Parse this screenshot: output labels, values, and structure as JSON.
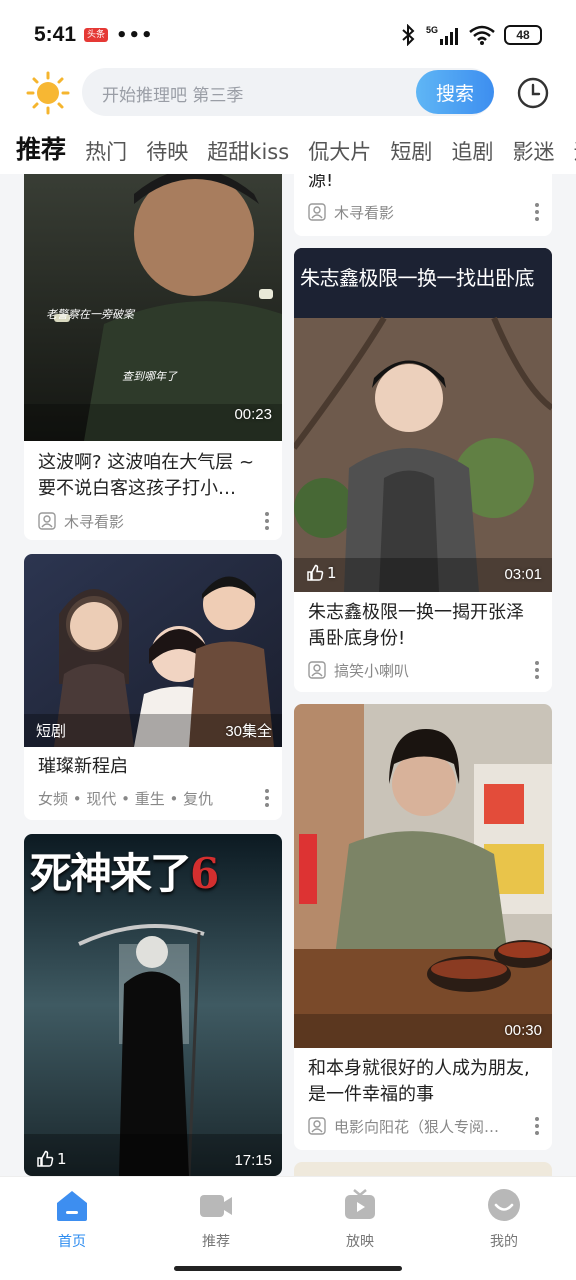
{
  "status_bar": {
    "time": "5:41",
    "badge": "头条",
    "battery": "48",
    "signal_label": "5G"
  },
  "search": {
    "placeholder": "开始推理吧 第三季",
    "button_label": "搜索"
  },
  "tabs": [
    "推荐",
    "热门",
    "待映",
    "超甜kiss",
    "侃大片",
    "短剧",
    "追剧",
    "影迷",
    "追"
  ],
  "feed": {
    "left": [
      {
        "caption1": "老警察在一旁破案",
        "caption2": "查到哪年了",
        "duration": "00:23",
        "title": "这波啊? 这波咱在大气层 ~ 要不说白客这孩子打小…",
        "author": "木寻看影"
      },
      {
        "tag": "短剧",
        "episodes": "30集全",
        "title": "璀璨新程启",
        "meta": "女频 • 现代 • 重生 • 复仇"
      },
      {
        "poster_text": "死神来了",
        "poster_num": "6",
        "likes": "1",
        "duration": "17:15"
      }
    ],
    "right": [
      {
        "title_tail": "源!",
        "author": "木寻看影"
      },
      {
        "banner": "朱志鑫极限一换一找出卧底",
        "likes": "1",
        "duration": "03:01",
        "title": "朱志鑫极限一换一揭开张泽禹卧底身份!",
        "author": "搞笑小喇叭"
      },
      {
        "duration": "00:30",
        "title": "和本身就很好的人成为朋友, 是一件幸福的事",
        "author": "电影向阳花（狠人专阅…"
      }
    ]
  },
  "bottom_nav": [
    {
      "label": "首页",
      "icon": "home-icon",
      "active": true
    },
    {
      "label": "推荐",
      "icon": "video-camera-icon",
      "active": false
    },
    {
      "label": "放映",
      "icon": "tv-icon",
      "active": false
    },
    {
      "label": "我的",
      "icon": "profile-icon",
      "active": false
    }
  ],
  "colors": {
    "accent": "#2d8cf0",
    "search_btn": "#3d8ef0",
    "feed_bg": "#f4f5f7"
  }
}
